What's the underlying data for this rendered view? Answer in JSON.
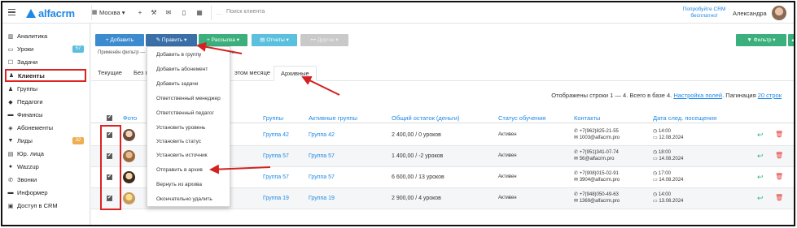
{
  "topbar": {
    "logo": "alfacrm",
    "branch": "Москва",
    "search_placeholder": "Поиск клиента",
    "promo": "Попробуйте CRM бесплатно!",
    "user": "Александра"
  },
  "sidebar": {
    "items": [
      {
        "label": "Аналитика",
        "icon": "chart-icon"
      },
      {
        "label": "Уроки",
        "icon": "calendar-icon",
        "badge": "57"
      },
      {
        "label": "Задачи",
        "icon": "tasks-icon"
      },
      {
        "label": "Клиенты",
        "icon": "user-icon"
      },
      {
        "label": "Группы",
        "icon": "group-icon"
      },
      {
        "label": "Педагоги",
        "icon": "teacher-icon"
      },
      {
        "label": "Финансы",
        "icon": "finance-icon"
      },
      {
        "label": "Абонементы",
        "icon": "tag-icon"
      },
      {
        "label": "Лиды",
        "icon": "funnel-icon",
        "badge": "32"
      },
      {
        "label": "Юр. лица",
        "icon": "building-icon"
      },
      {
        "label": "Wazzup",
        "icon": "chat-icon"
      },
      {
        "label": "Звонки",
        "icon": "phone-icon"
      },
      {
        "label": "Информер",
        "icon": "informer-icon"
      },
      {
        "label": "Доступ в CRM",
        "icon": "lock-icon"
      }
    ],
    "badge_colors": {
      "lessons": "#5bc0de",
      "leads": "#f0ad4e"
    }
  },
  "toolbar": {
    "add": "+ Добавить",
    "edit": "✎ Править ▾",
    "mailing": "+ Рассылка ▾",
    "reports": "▤ Отчеты ▾",
    "other": "••• Другое ▾",
    "filter": "▼ Фильтр ▾"
  },
  "filter_line": {
    "applied": "Применён фильтр —",
    "link": "ть"
  },
  "tabs": [
    {
      "label": "Текущие"
    },
    {
      "label": "Без г"
    },
    {
      "label": "этом месяце"
    },
    {
      "label": "Архивные",
      "active": true
    }
  ],
  "stats": {
    "text": "Отображены строки 1 — 4. Всего в базе 4.",
    "settings": "Настройка полей",
    "pagination": "Пагинация",
    "per_page": "20 строк"
  },
  "table": {
    "headers": {
      "photo": "Фото",
      "groups": "Группы",
      "active_groups": "Активные группы",
      "balance": "Общий остаток (деньги)",
      "status": "Статус обучения",
      "contacts": "Контакты",
      "next_visit": "Дата след. посещения"
    },
    "rows": [
      {
        "group": "Группа 42",
        "active_group": "Группа 42",
        "balance": "2 400,00 / 0 уроков",
        "status": "Активен",
        "phone": "✆ +7(962)825-21-55",
        "email": "✉ 1003@alfacrm.pro",
        "time": "◷ 14:00",
        "date": "▭ 12.08.2024"
      },
      {
        "group": "Группа 57",
        "active_group": "Группа 57",
        "balance": "1 400,00 / -2 уроков",
        "status": "Активен",
        "phone": "✆ +7(951)341-07-74",
        "email": "✉ 56@alfacrm.pro",
        "time": "◷ 18:00",
        "date": "▭ 14.08.2024"
      },
      {
        "group": "Группа 57",
        "active_group": "Группа 57",
        "balance": "6 600,00 / 13 уроков",
        "status": "Активен",
        "phone": "✆ +7(908)015-02-91",
        "email": "✉ 3904@alfacrm.pro",
        "time": "◷ 17:00",
        "date": "▭ 14.08.2024"
      },
      {
        "group": "Группа 19",
        "active_group": "Группа 19",
        "balance": "2 900,00 / 4 уроков",
        "status": "Активен",
        "phone": "✆ +7(948)050-49-63",
        "email": "✉ 1369@alfacrm.pro",
        "time": "◷ 14:00",
        "date": "▭ 13.08.2024"
      }
    ]
  },
  "dropdown": {
    "items": [
      "Добавить в группу",
      "Добавить абонемент",
      "Добавить задачи",
      "Ответственный менеджер",
      "Ответственный педагог",
      "Установить уровень",
      "Установить статус",
      "Установить источник",
      "Отправить в архив",
      "Вернуть из архива",
      "Окончательно удалить"
    ]
  },
  "annotation_color": "#d22222"
}
